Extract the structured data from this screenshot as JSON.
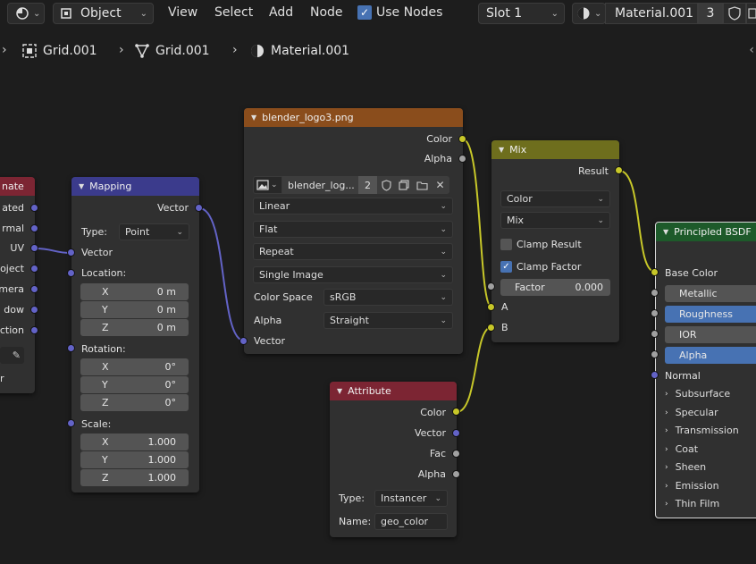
{
  "header": {
    "object_mode": "Object",
    "menus": [
      "View",
      "Select",
      "Add",
      "Node"
    ],
    "use_nodes_label": "Use Nodes",
    "use_nodes_checked": true,
    "slot": "Slot 1",
    "material": "Material.001",
    "users": "3"
  },
  "breadcrumb": {
    "items": [
      "Grid.001",
      "Grid.001",
      "Material.001"
    ]
  },
  "nodes": {
    "partial_left": {
      "title": "nate",
      "outputs": [
        "ated",
        "rmal",
        "UV",
        "oject",
        "mera",
        "dow",
        "ction"
      ],
      "last": "r"
    },
    "mapping": {
      "title": "Mapping",
      "out_vector": "Vector",
      "type_label": "Type:",
      "type_value": "Point",
      "in_vector": "Vector",
      "location_label": "Location:",
      "location": [
        {
          "axis": "X",
          "value": "0 m"
        },
        {
          "axis": "Y",
          "value": "0 m"
        },
        {
          "axis": "Z",
          "value": "0 m"
        }
      ],
      "rotation_label": "Rotation:",
      "rotation": [
        {
          "axis": "X",
          "value": "0°"
        },
        {
          "axis": "Y",
          "value": "0°"
        },
        {
          "axis": "Z",
          "value": "0°"
        }
      ],
      "scale_label": "Scale:",
      "scale": [
        {
          "axis": "X",
          "value": "1.000"
        },
        {
          "axis": "Y",
          "value": "1.000"
        },
        {
          "axis": "Z",
          "value": "1.000"
        }
      ]
    },
    "image": {
      "title": "blender_logo3.png",
      "out_color": "Color",
      "out_alpha": "Alpha",
      "image_name": "blender_log...",
      "image_users": "2",
      "interpolation": "Linear",
      "projection": "Flat",
      "extension": "Repeat",
      "source": "Single Image",
      "color_space_label": "Color Space",
      "color_space": "sRGB",
      "alpha_label": "Alpha",
      "alpha_mode": "Straight",
      "in_vector": "Vector"
    },
    "mix": {
      "title": "Mix",
      "out_result": "Result",
      "data_type": "Color",
      "blend": "Mix",
      "clamp_result_label": "Clamp Result",
      "clamp_result": false,
      "clamp_factor_label": "Clamp Factor",
      "clamp_factor": true,
      "factor_label": "Factor",
      "factor_value": "0.000",
      "in_a": "A",
      "in_b": "B"
    },
    "attribute": {
      "title": "Attribute",
      "outputs": [
        "Color",
        "Vector",
        "Fac",
        "Alpha"
      ],
      "type_label": "Type:",
      "type_value": "Instancer",
      "name_label": "Name:",
      "name_value": "geo_color"
    },
    "bsdf": {
      "title": "Principled BSDF",
      "base_color": "Base Color",
      "metallic": "Metallic",
      "roughness": "Roughness",
      "ior": "IOR",
      "alpha": "Alpha",
      "normal": "Normal",
      "panels": [
        "Subsurface",
        "Specular",
        "Transmission",
        "Coat",
        "Sheen",
        "Emission",
        "Thin Film"
      ]
    }
  },
  "colors": {
    "mapping_header": "#3b3b8c",
    "image_header": "#8a4d1c",
    "mix_header": "#6e6e1d",
    "attribute_header": "#7c2533",
    "bsdf_header": "#1d5a2a",
    "partial_header": "#7c2533",
    "yellow_socket": "#c7c729",
    "purple_socket": "#6363c7",
    "grey_socket": "#a1a1a1",
    "accent_blue": "#4772b3"
  }
}
